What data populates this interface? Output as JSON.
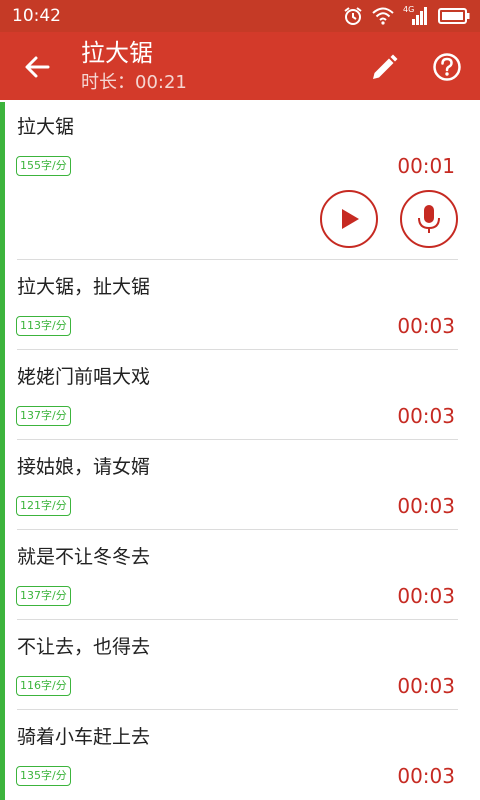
{
  "status": {
    "time": "10:42",
    "network": "4G"
  },
  "header": {
    "title": "拉大锯",
    "subtitle": "时长：00:21"
  },
  "items": [
    {
      "text": "拉大锯",
      "speed": "155字/分",
      "duration": "00:01"
    },
    {
      "text": "拉大锯，扯大锯",
      "speed": "113字/分",
      "duration": "00:03"
    },
    {
      "text": "姥姥门前唱大戏",
      "speed": "137字/分",
      "duration": "00:03"
    },
    {
      "text": "接姑娘，请女婿",
      "speed": "121字/分",
      "duration": "00:03"
    },
    {
      "text": "就是不让冬冬去",
      "speed": "137字/分",
      "duration": "00:03"
    },
    {
      "text": "不让去，也得去",
      "speed": "116字/分",
      "duration": "00:03"
    },
    {
      "text": "骑着小车赶上去",
      "speed": "135字/分",
      "duration": "00:03"
    }
  ],
  "colors": {
    "appbar": "#d33a2a",
    "statusbar": "#c53a26",
    "accent": "#c62a22",
    "speed_green": "#3cb43c"
  },
  "icons": [
    "back-arrow-icon",
    "edit-pencil-icon",
    "help-icon",
    "play-icon",
    "microphone-icon"
  ]
}
